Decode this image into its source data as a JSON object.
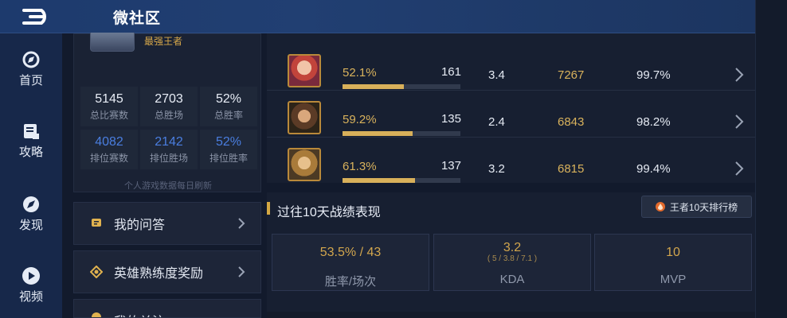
{
  "header": {
    "title": "微社区"
  },
  "nav": [
    {
      "label": "首页",
      "icon": "compass-icon"
    },
    {
      "label": "攻略",
      "icon": "guide-icon"
    },
    {
      "label": "发现",
      "icon": "discover-icon"
    },
    {
      "label": "视频",
      "icon": "play-icon"
    }
  ],
  "profile": {
    "rank_title": "最强王者",
    "stats": [
      {
        "value": "5145",
        "label": "总比赛数"
      },
      {
        "value": "2703",
        "label": "总胜场"
      },
      {
        "value": "52%",
        "label": "总胜率"
      },
      {
        "value": "4082",
        "label": "排位赛数"
      },
      {
        "value": "2142",
        "label": "排位胜场"
      },
      {
        "value": "52%",
        "label": "排位胜率"
      }
    ],
    "refresh_note": "个人游戏数据每日刷新"
  },
  "menu": [
    {
      "label": "我的问答",
      "icon": "message-icon"
    },
    {
      "label": "英雄熟练度奖励",
      "icon": "medal-icon"
    },
    {
      "label": "我的关注",
      "icon": "star-icon"
    }
  ],
  "heroes": [
    {
      "win_rate": "52.1%",
      "win_rate_value": 0.521,
      "games": "161",
      "kda": "3.4",
      "power": "7267",
      "rating": "99.7%"
    },
    {
      "win_rate": "59.2%",
      "win_rate_value": 0.592,
      "games": "135",
      "kda": "2.4",
      "power": "6843",
      "rating": "98.2%"
    },
    {
      "win_rate": "61.3%",
      "win_rate_value": 0.613,
      "games": "137",
      "kda": "3.2",
      "power": "6815",
      "rating": "99.4%"
    }
  ],
  "performance": {
    "title": "过往10天战绩表现",
    "rank_button": "王者10天排行榜",
    "boxes": [
      {
        "value": "53.5% / 43",
        "sub": "",
        "label": "胜率/场次"
      },
      {
        "value": "3.2",
        "sub": "( 5 / 3.8 / 7.1 )",
        "label": "KDA"
      },
      {
        "value": "10",
        "sub": "",
        "label": "MVP"
      }
    ]
  },
  "colors": {
    "accent_gold": "#d8b05a",
    "nav_bg": "#17284a",
    "header_bg": "#1d3a6d",
    "blue_stat": "#4a7ee0"
  }
}
